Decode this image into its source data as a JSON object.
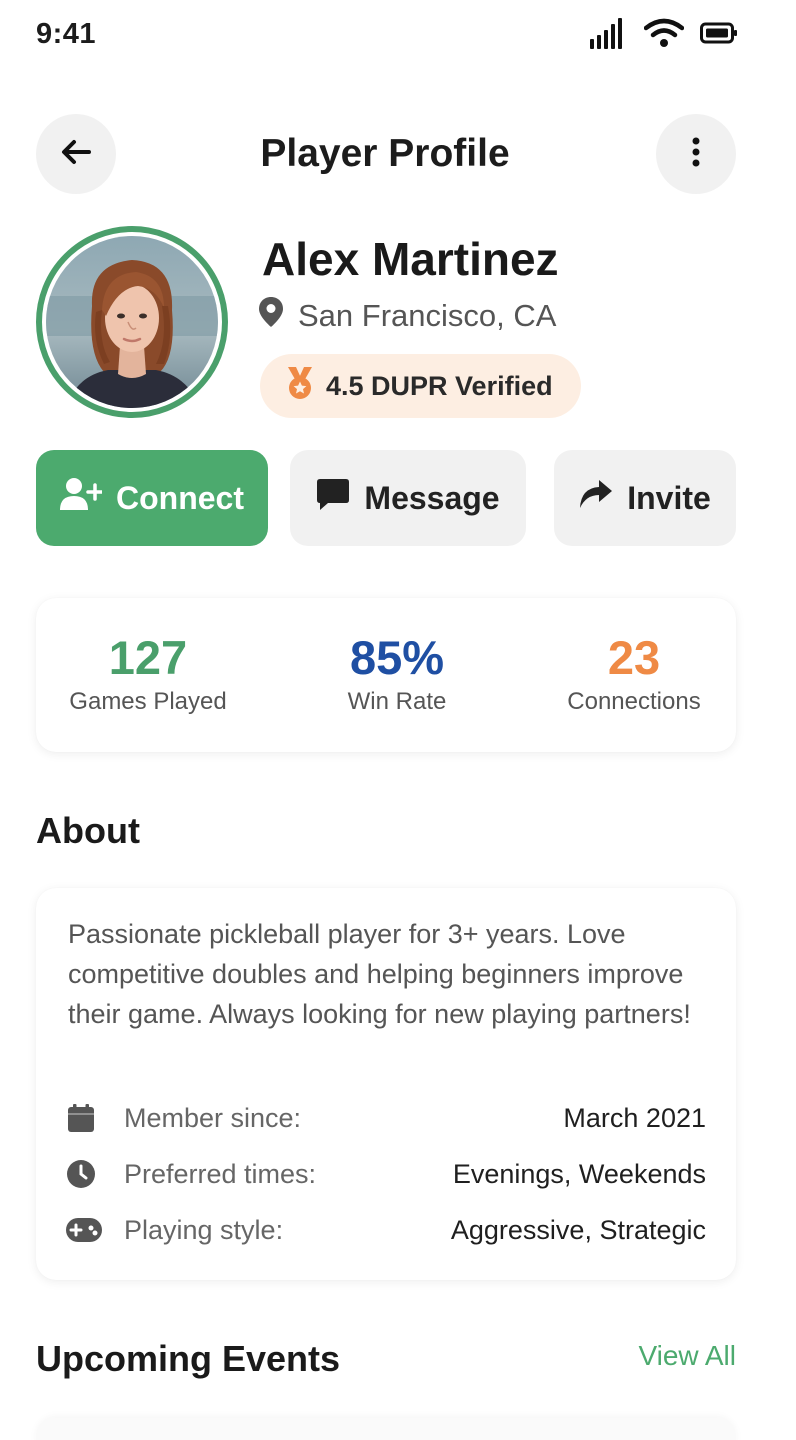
{
  "status_bar": {
    "time": "9:41"
  },
  "nav": {
    "title": "Player Profile"
  },
  "profile": {
    "name": "Alex Martinez",
    "location": "San Francisco, CA",
    "badge": "4.5 DUPR Verified"
  },
  "actions": {
    "connect": "Connect",
    "message": "Message",
    "invite": "Invite"
  },
  "stats": [
    {
      "value": "127",
      "label": "Games Played",
      "color": "#4a9f6b"
    },
    {
      "value": "85%",
      "label": "Win Rate",
      "color": "#1f4fa3"
    },
    {
      "value": "23",
      "label": "Connections",
      "color": "#ef8a45"
    }
  ],
  "about": {
    "title": "About",
    "text": "Passionate pickleball player for 3+ years. Love competitive doubles and helping beginners improve their game. Always looking for new playing partners!",
    "rows": [
      {
        "icon": "calendar-icon",
        "label": "Member since:",
        "value": "March 2021"
      },
      {
        "icon": "clock-icon",
        "label": "Preferred times:",
        "value": "Evenings, Weekends"
      },
      {
        "icon": "gamepad-icon",
        "label": "Playing style:",
        "value": "Aggressive, Strategic"
      }
    ]
  },
  "events": {
    "title": "Upcoming Events",
    "view_all": "View All"
  },
  "colors": {
    "accent_green": "#4caa6e",
    "badge_bg": "#fdeee2",
    "badge_icon": "#ef8a45"
  }
}
